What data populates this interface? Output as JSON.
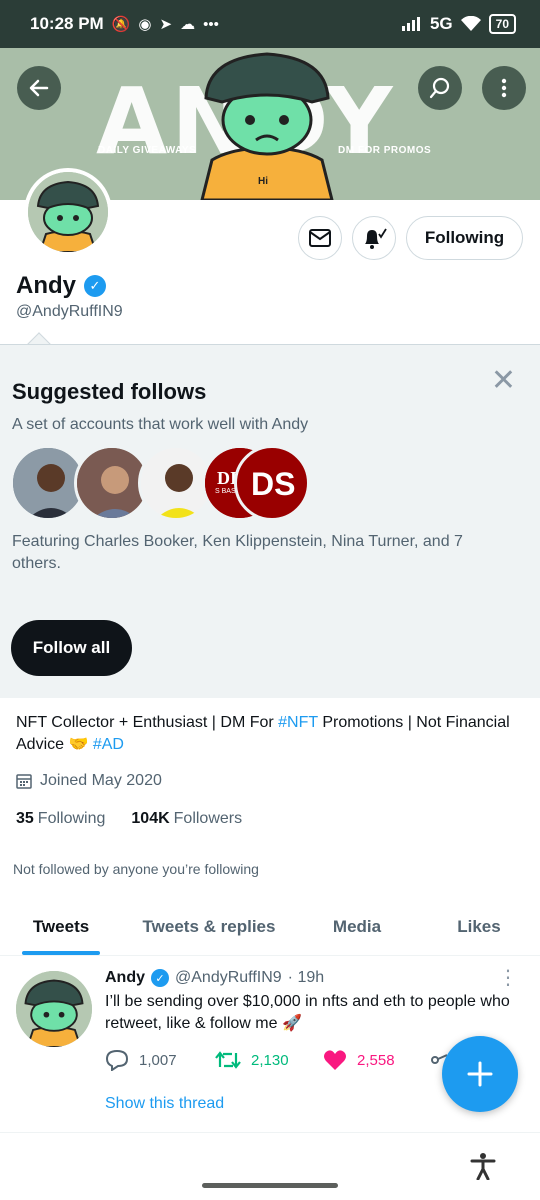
{
  "status_bar": {
    "time": "10:28 PM",
    "network": "5G",
    "battery": "70",
    "more": "•••"
  },
  "banner": {
    "big_text": "ANDY",
    "left_text": "DAILY GIVEAWAYS",
    "right_text": "DM FOR PROMOS",
    "shirt_text": "Hi"
  },
  "profile": {
    "name": "Andy",
    "handle": "@AndyRuffIN9",
    "following_label": "Following",
    "bio_part1": "NFT Collector + Enthusiast | DM For ",
    "bio_tag1": "#NFT",
    "bio_part2": " Promotions | Not Financial Advice 🤝 ",
    "bio_tag2": "#AD",
    "joined": "Joined May 2020",
    "following_count": "35",
    "following_text": "Following",
    "followers_count": "104K",
    "followers_text": "Followers",
    "not_followed": "Not followed by anyone you’re following"
  },
  "suggested": {
    "title": "Suggested follows",
    "subtitle": "A set of accounts that work well with Andy",
    "featuring": "Featuring Charles Booker, Ken Klippenstein, Nina Turner, and 7 others.",
    "follow_all": "Follow all",
    "indiana_text": "DIANA",
    "indiana_sub": "S BASKETBALL",
    "ds_text": "DS"
  },
  "tabs": [
    {
      "label": "Tweets"
    },
    {
      "label": "Tweets & replies"
    },
    {
      "label": "Media"
    },
    {
      "label": "Likes"
    }
  ],
  "tweet": {
    "name": "Andy",
    "handle": "@AndyRuffIN9",
    "time": "· 19h",
    "text": "I’ll be sending over $10,000 in nfts and eth to people who retweet, like & follow me 🚀",
    "replies": "1,007",
    "retweets": "2,130",
    "likes": "2,558",
    "show_thread": "Show this thread"
  },
  "colors": {
    "accent": "#1d9bf0",
    "retweet": "#00ba7c",
    "like": "#f91880",
    "banner": "#a9bea8"
  }
}
